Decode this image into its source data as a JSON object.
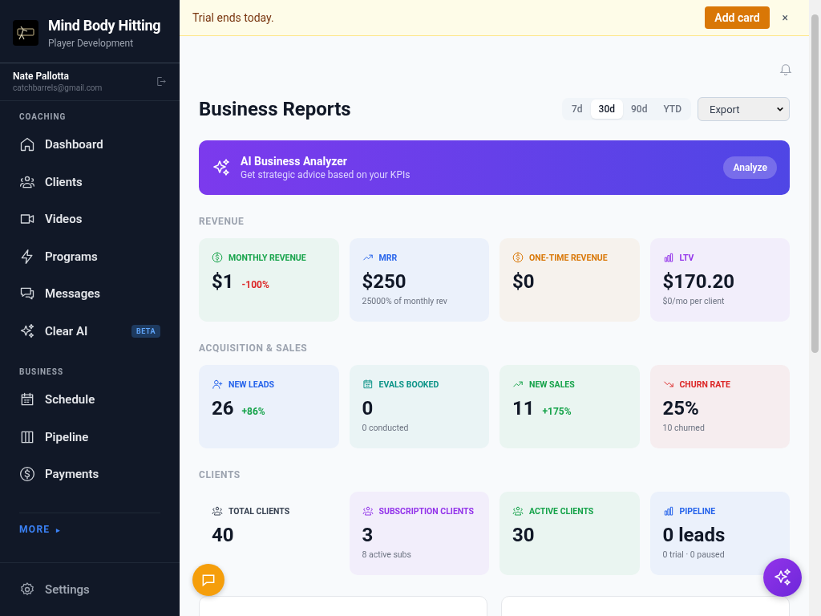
{
  "brand": {
    "name": "Mind Body Hitting",
    "subtitle": "Player Development"
  },
  "user": {
    "name": "Nate Pallotta",
    "email": "catchbarrels@gmail.com"
  },
  "sidebar": {
    "sections": [
      {
        "title": "COACHING",
        "items": [
          {
            "label": "Dashboard",
            "kind": "home",
            "selected": false
          },
          {
            "label": "Clients",
            "kind": "users",
            "selected": false
          },
          {
            "label": "Videos",
            "kind": "video",
            "selected": false
          },
          {
            "label": "Programs",
            "kind": "bolt",
            "selected": false
          },
          {
            "label": "Messages",
            "kind": "chat",
            "selected": false
          },
          {
            "label": "Clear AI",
            "kind": "sparkles",
            "selected": false,
            "badge": "BETA"
          }
        ]
      },
      {
        "title": "BUSINESS",
        "items": [
          {
            "label": "Schedule",
            "kind": "calendar",
            "selected": false
          },
          {
            "label": "Pipeline",
            "kind": "columns",
            "selected": false
          },
          {
            "label": "Payments",
            "kind": "dollar",
            "selected": false
          }
        ]
      }
    ],
    "more": {
      "label": "MORE",
      "arrow": "▸"
    },
    "settings": {
      "label": "Settings"
    }
  },
  "banner": {
    "text": "Trial ends today.",
    "button": "Add card",
    "close": "×"
  },
  "page": {
    "title": "Business Reports",
    "periods": [
      {
        "label": "7d",
        "selected": false
      },
      {
        "label": "30d",
        "selected": true
      },
      {
        "label": "90d",
        "selected": false
      },
      {
        "label": "YTD",
        "selected": false
      }
    ],
    "export": {
      "value": "Export"
    }
  },
  "ai_banner": {
    "title": "AI Business Analyzer",
    "subtitle": "Get strategic advice based on your KPIs",
    "button": "Analyze"
  },
  "sections": [
    {
      "title": "REVENUE",
      "cards": [
        {
          "label": "MONTHLY REVENUE",
          "kind": "dollar",
          "color": "#16a34a",
          "tinted": true,
          "value": "$1",
          "change": "-100%",
          "negative": true
        },
        {
          "label": "MRR",
          "kind": "trend-up",
          "color": "#2563eb",
          "tinted": true,
          "value": "$250",
          "note": "25000% of monthly rev"
        },
        {
          "label": "ONE-TIME REVENUE",
          "kind": "dollar",
          "color": "#d97706",
          "tinted": true,
          "value": "$0"
        },
        {
          "label": "LTV",
          "kind": "bars",
          "color": "#9333ea",
          "tinted": true,
          "value": "$170.20",
          "note": "$0/mo per client"
        }
      ]
    },
    {
      "title": "ACQUISITION & SALES",
      "cards": [
        {
          "label": "NEW LEADS",
          "kind": "user-plus",
          "color": "#2563eb",
          "tinted": true,
          "value": "26",
          "change": "+86%",
          "negative": false
        },
        {
          "label": "EVALS BOOKED",
          "kind": "calendar",
          "color": "#0d9488",
          "tinted": true,
          "value": "0",
          "note": "0 conducted"
        },
        {
          "label": "NEW SALES",
          "kind": "trend-up",
          "color": "#16a34a",
          "tinted": true,
          "value": "11",
          "change": "+175%",
          "negative": false
        },
        {
          "label": "CHURN RATE",
          "kind": "trend-down",
          "color": "#dc2626",
          "tinted": true,
          "value": "25%",
          "note": "10 churned"
        }
      ]
    },
    {
      "title": "CLIENTS",
      "cards": [
        {
          "label": "TOTAL CLIENTS",
          "kind": "users",
          "color": "#374151",
          "tinted": false,
          "value": "40"
        },
        {
          "label": "SUBSCRIPTION CLIENTS",
          "kind": "users",
          "color": "#9333ea",
          "tinted": true,
          "value": "3",
          "note": "8 active subs"
        },
        {
          "label": "ACTIVE CLIENTS",
          "kind": "users",
          "color": "#16a34a",
          "tinted": true,
          "value": "30"
        },
        {
          "label": "PIPELINE",
          "kind": "bars",
          "color": "#2563eb",
          "tinted": true,
          "value": "0 leads",
          "note": "0 trial · 0 paused"
        }
      ]
    }
  ]
}
